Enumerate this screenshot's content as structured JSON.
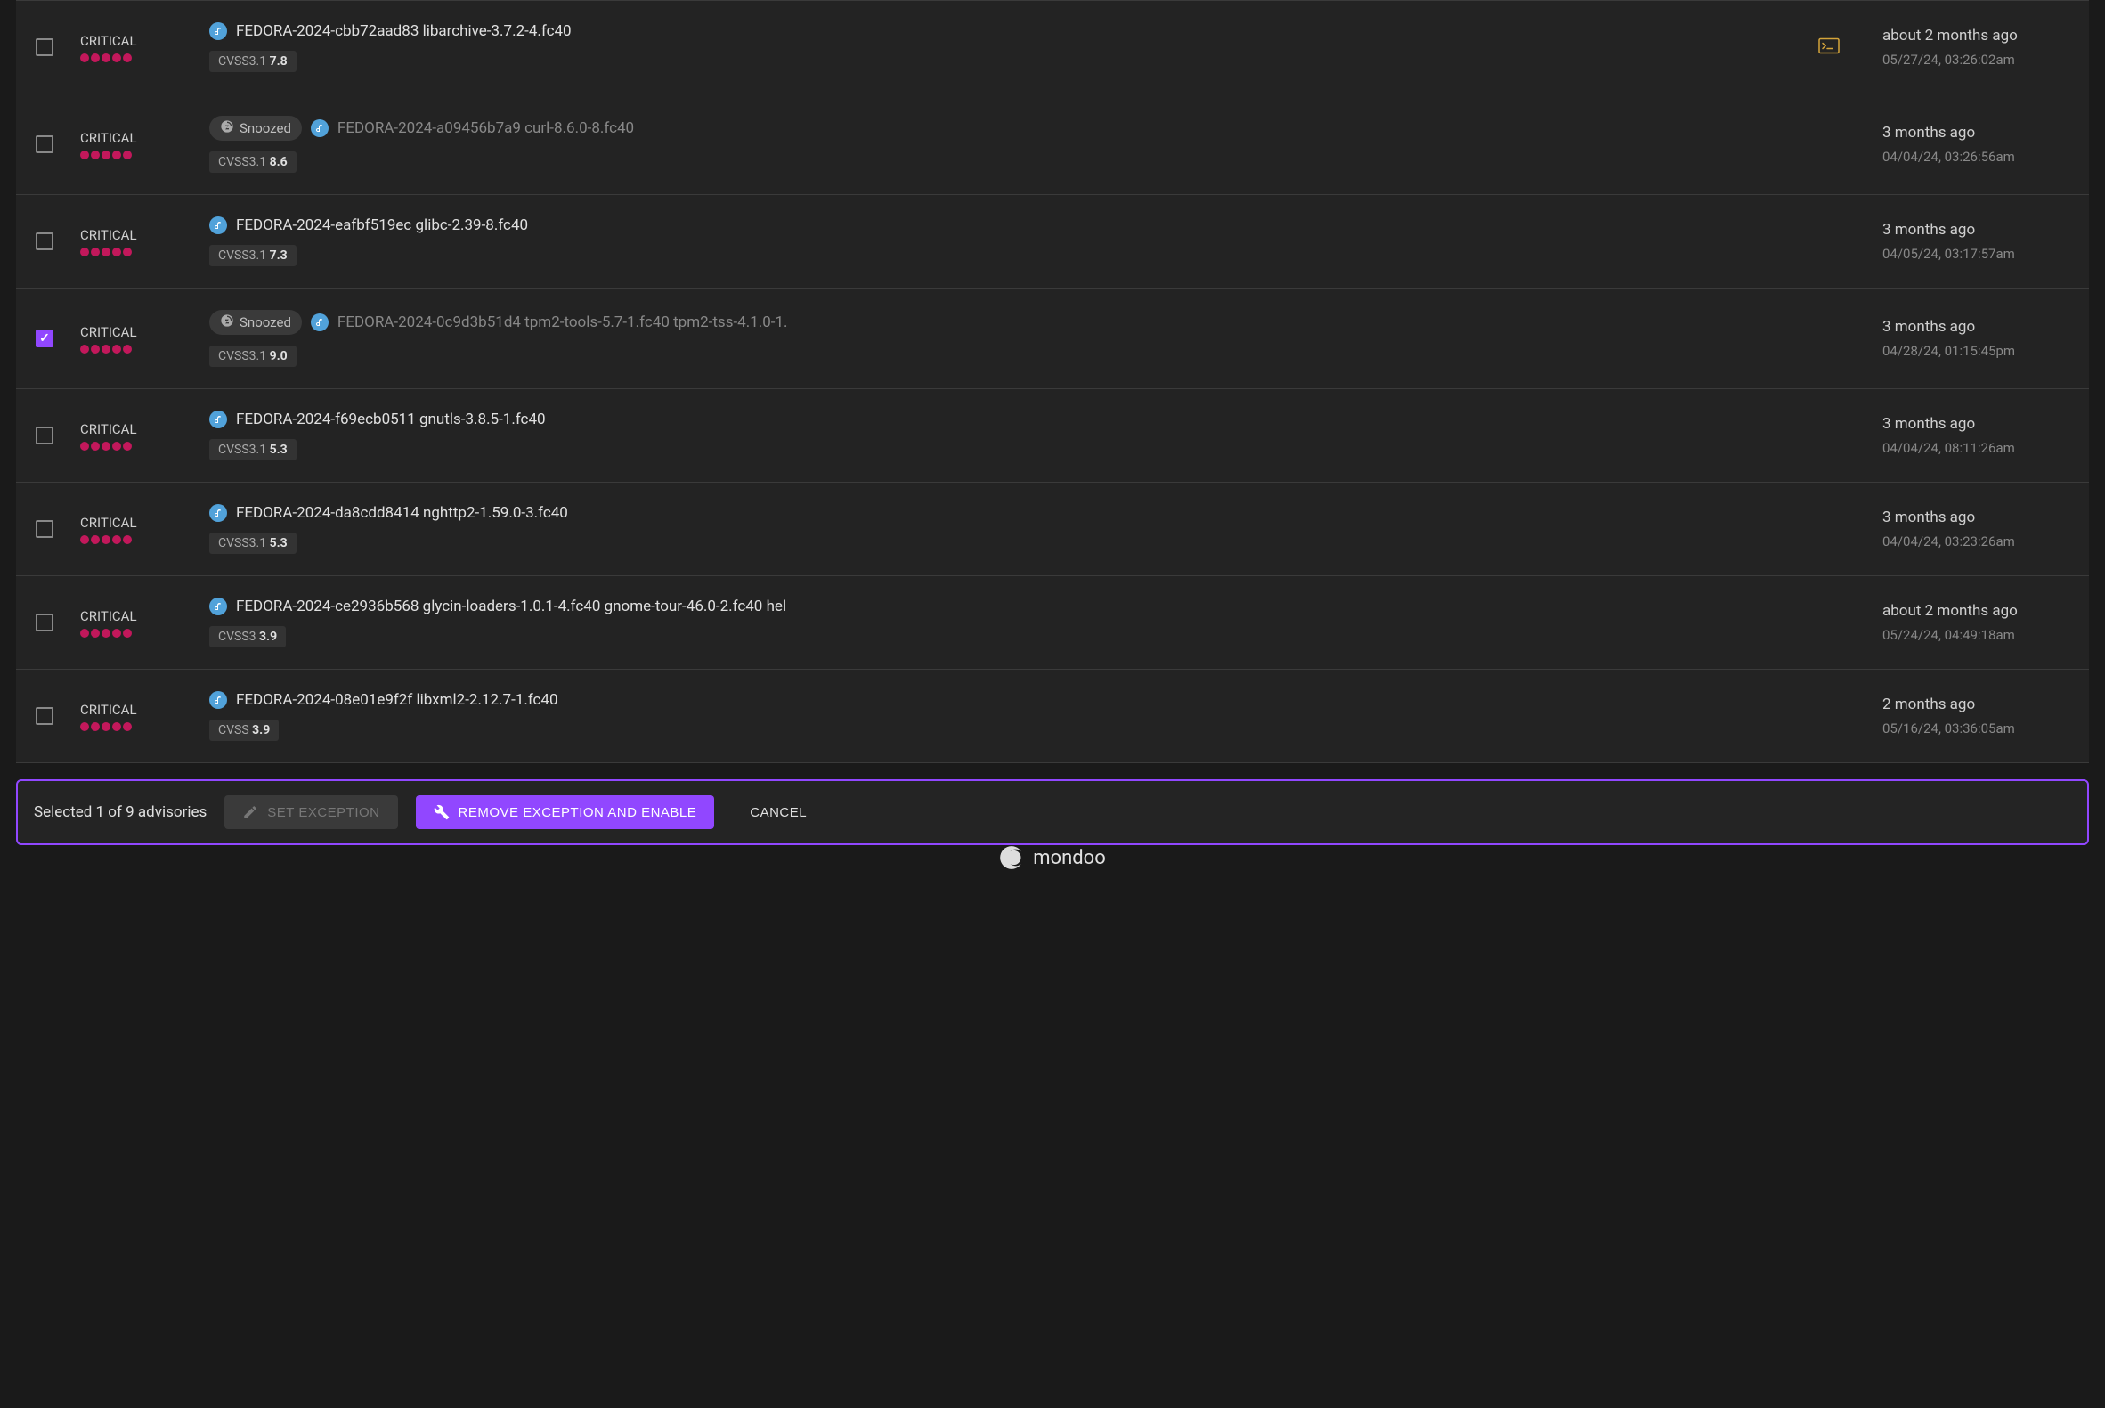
{
  "severity_label": "CRITICAL",
  "snoozed_label": "Snoozed",
  "cvss_prefix_31": "CVSS3.1",
  "cvss_prefix_3": "CVSS3",
  "cvss_prefix": "CVSS",
  "advisories": [
    {
      "title": "FEDORA-2024-cbb72aad83 libarchive-3.7.2-4.fc40",
      "snoozed": false,
      "cvss_prefix": "CVSS3.1",
      "cvss_score": "7.8",
      "has_shell": true,
      "relative": "about 2 months ago",
      "absolute": "05/27/24, 03:26:02am",
      "checked": false
    },
    {
      "title": "FEDORA-2024-a09456b7a9 curl-8.6.0-8.fc40",
      "snoozed": true,
      "cvss_prefix": "CVSS3.1",
      "cvss_score": "8.6",
      "has_shell": false,
      "relative": "3 months ago",
      "absolute": "04/04/24, 03:26:56am",
      "checked": false
    },
    {
      "title": "FEDORA-2024-eafbf519ec glibc-2.39-8.fc40",
      "snoozed": false,
      "cvss_prefix": "CVSS3.1",
      "cvss_score": "7.3",
      "has_shell": false,
      "relative": "3 months ago",
      "absolute": "04/05/24, 03:17:57am",
      "checked": false
    },
    {
      "title": "FEDORA-2024-0c9d3b51d4 tpm2-tools-5.7-1.fc40 tpm2-tss-4.1.0-1.",
      "snoozed": true,
      "cvss_prefix": "CVSS3.1",
      "cvss_score": "9.0",
      "has_shell": false,
      "relative": "3 months ago",
      "absolute": "04/28/24, 01:15:45pm",
      "checked": true
    },
    {
      "title": "FEDORA-2024-f69ecb0511 gnutls-3.8.5-1.fc40",
      "snoozed": false,
      "cvss_prefix": "CVSS3.1",
      "cvss_score": "5.3",
      "has_shell": false,
      "relative": "3 months ago",
      "absolute": "04/04/24, 08:11:26am",
      "checked": false
    },
    {
      "title": "FEDORA-2024-da8cdd8414 nghttp2-1.59.0-3.fc40",
      "snoozed": false,
      "cvss_prefix": "CVSS3.1",
      "cvss_score": "5.3",
      "has_shell": false,
      "relative": "3 months ago",
      "absolute": "04/04/24, 03:23:26am",
      "checked": false
    },
    {
      "title": "FEDORA-2024-ce2936b568 glycin-loaders-1.0.1-4.fc40 gnome-tour-46.0-2.fc40 hel",
      "snoozed": false,
      "cvss_prefix": "CVSS3",
      "cvss_score": "3.9",
      "has_shell": false,
      "relative": "about 2 months ago",
      "absolute": "05/24/24, 04:49:18am",
      "checked": false
    },
    {
      "title": "FEDORA-2024-08e01e9f2f libxml2-2.12.7-1.fc40",
      "snoozed": false,
      "cvss_prefix": "CVSS",
      "cvss_score": "3.9",
      "has_shell": false,
      "relative": "2 months ago",
      "absolute": "05/16/24, 03:36:05am",
      "checked": false
    }
  ],
  "action_bar": {
    "selection_text": "Selected 1 of 9 advisories",
    "set_exception": "SET EXCEPTION",
    "remove_exception": "REMOVE EXCEPTION AND ENABLE",
    "cancel": "CANCEL"
  },
  "footer": {
    "brand": "mondoo"
  }
}
